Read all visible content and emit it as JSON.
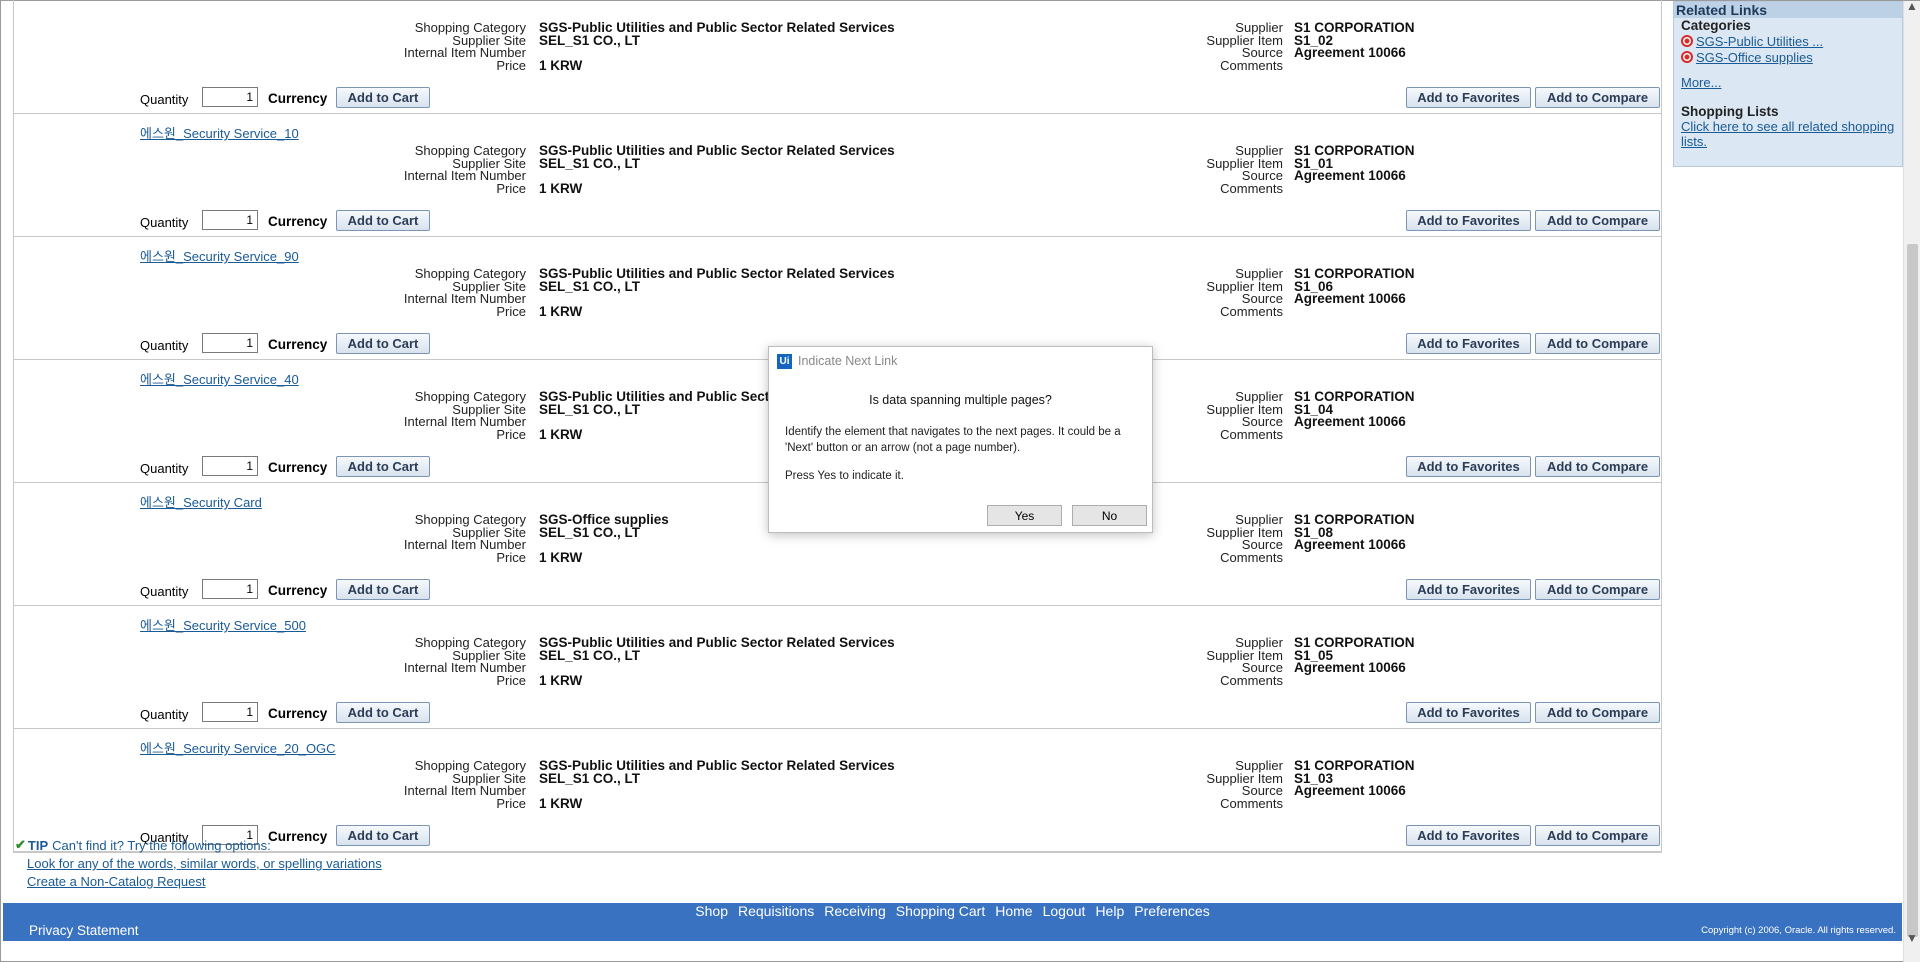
{
  "labels": {
    "shopping_category": "Shopping Category",
    "supplier_site": "Supplier Site",
    "internal_item_number": "Internal Item Number",
    "price": "Price",
    "supplier": "Supplier",
    "supplier_item": "Supplier Item",
    "source": "Source",
    "comments": "Comments",
    "quantity": "Quantity",
    "currency": "Currency",
    "add_to_cart": "Add to Cart",
    "add_to_favorites": "Add to Favorites",
    "add_to_compare": "Add to Compare"
  },
  "items": [
    {
      "title": "",
      "category": "SGS-Public Utilities and Public Sector Related Services",
      "supplier_site": "SEL_S1 CO., LT",
      "internal_item_number": "",
      "price": "1  KRW",
      "supplier": "S1 CORPORATION",
      "supplier_item": "S1_02",
      "source": "Agreement 10066",
      "comments": "",
      "quantity": "1"
    },
    {
      "title": "에스원_Security Service_10",
      "category": "SGS-Public Utilities and Public Sector Related Services",
      "supplier_site": "SEL_S1 CO., LT",
      "internal_item_number": "",
      "price": "1  KRW",
      "supplier": "S1 CORPORATION",
      "supplier_item": "S1_01",
      "source": "Agreement 10066",
      "comments": "",
      "quantity": "1"
    },
    {
      "title": "에스원_Security Service_90",
      "category": "SGS-Public Utilities and Public Sector Related Services",
      "supplier_site": "SEL_S1 CO., LT",
      "internal_item_number": "",
      "price": "1  KRW",
      "supplier": "S1 CORPORATION",
      "supplier_item": "S1_06",
      "source": "Agreement 10066",
      "comments": "",
      "quantity": "1"
    },
    {
      "title": "에스원_Security Service_40",
      "category": "SGS-Public Utilities and Public Sector Related Services",
      "supplier_site": "SEL_S1 CO., LT",
      "internal_item_number": "",
      "price": "1  KRW",
      "supplier": "S1 CORPORATION",
      "supplier_item": "S1_04",
      "source": "Agreement 10066",
      "comments": "",
      "quantity": "1"
    },
    {
      "title": "에스원_Security Card",
      "category": "SGS-Office supplies",
      "supplier_site": "SEL_S1 CO., LT",
      "internal_item_number": "",
      "price": "1  KRW",
      "supplier": "S1 CORPORATION",
      "supplier_item": "S1_08",
      "source": "Agreement 10066",
      "comments": "",
      "quantity": "1"
    },
    {
      "title": "에스원_Security Service_500",
      "category": "SGS-Public Utilities and Public Sector Related Services",
      "supplier_site": "SEL_S1 CO., LT",
      "internal_item_number": "",
      "price": "1  KRW",
      "supplier": "S1 CORPORATION",
      "supplier_item": "S1_05",
      "source": "Agreement 10066",
      "comments": "",
      "quantity": "1"
    },
    {
      "title": "에스원_Security Service_20_OGC",
      "category": "SGS-Public Utilities and Public Sector Related Services",
      "supplier_site": "SEL_S1 CO., LT",
      "internal_item_number": "",
      "price": "1  KRW",
      "supplier": "S1 CORPORATION",
      "supplier_item": "S1_03",
      "source": "Agreement 10066",
      "comments": "",
      "quantity": "1"
    }
  ],
  "sidebar": {
    "title": "Related Links",
    "categories_label": "Categories",
    "categories": [
      "SGS-Public Utilities ...",
      "SGS-Office supplies"
    ],
    "more": "More...",
    "shopping_lists_label": "Shopping Lists",
    "shopping_lists_link": "Click here to see all related shopping lists."
  },
  "tips": {
    "label": "TIP",
    "text": "Can't find it? Try the following options:",
    "link1": "Look for any of the words, similar words, or spelling variations",
    "link2": "Create a Non-Catalog Request"
  },
  "footer": {
    "nav": [
      "Shop",
      "Requisitions",
      "Receiving",
      "Shopping Cart",
      "Home",
      "Logout",
      "Help",
      "Preferences"
    ],
    "privacy": "Privacy Statement",
    "copyright": "Copyright (c) 2006, Oracle. All rights reserved."
  },
  "dialog": {
    "icon_text": "Ui",
    "title": "Indicate Next Link",
    "heading": "Is data spanning multiple pages?",
    "body": "Identify the element that navigates to the next pages. It could be a 'Next' button or an arrow (not a page number).",
    "press": "Press Yes to indicate it.",
    "yes": "Yes",
    "no": "No"
  }
}
